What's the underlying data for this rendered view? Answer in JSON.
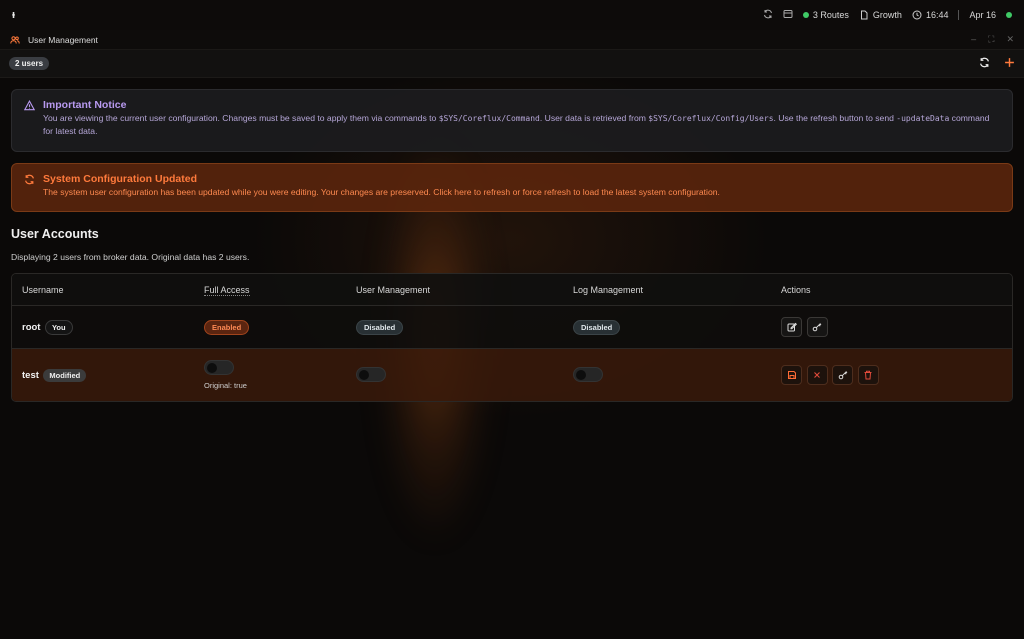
{
  "topbar": {
    "logo": "ᵻ",
    "routes": "3 Routes",
    "plan": "Growth",
    "time": "16:44",
    "date": "Apr 16"
  },
  "window": {
    "title": "User Management"
  },
  "toolbar": {
    "user_count": "2 users"
  },
  "notices": {
    "important": {
      "title": "Important Notice",
      "text1": "You are viewing the current user configuration. Changes must be saved to apply them via commands to ",
      "code1": "$SYS/Coreflux/Command",
      "text2": ". User data is retrieved from ",
      "code2": "$SYS/Coreflux/Config/Users",
      "text3": ". Use the refresh button to send ",
      "code3": "-updateData",
      "text4": " command for latest data."
    },
    "updated": {
      "title": "System Configuration Updated",
      "text": "The system user configuration has been updated while you were editing. Your changes are preserved. Click here to refresh or force refresh to load the latest system configuration."
    }
  },
  "accounts": {
    "heading": "User Accounts",
    "summary": "Displaying 2 users from broker data. Original data has 2 users.",
    "columns": [
      "Username",
      "Full Access",
      "User Management",
      "Log Management",
      "Actions"
    ],
    "rows": [
      {
        "username": "root",
        "tag": "You",
        "full_access": "Enabled",
        "user_management": "Disabled",
        "log_management": "Disabled"
      },
      {
        "username": "test",
        "tag": "Modified",
        "full_access_original": "Original: true"
      }
    ]
  },
  "colors": {
    "accent": "#ff7a3c",
    "info": "#b89af0",
    "online": "#3fca66"
  }
}
